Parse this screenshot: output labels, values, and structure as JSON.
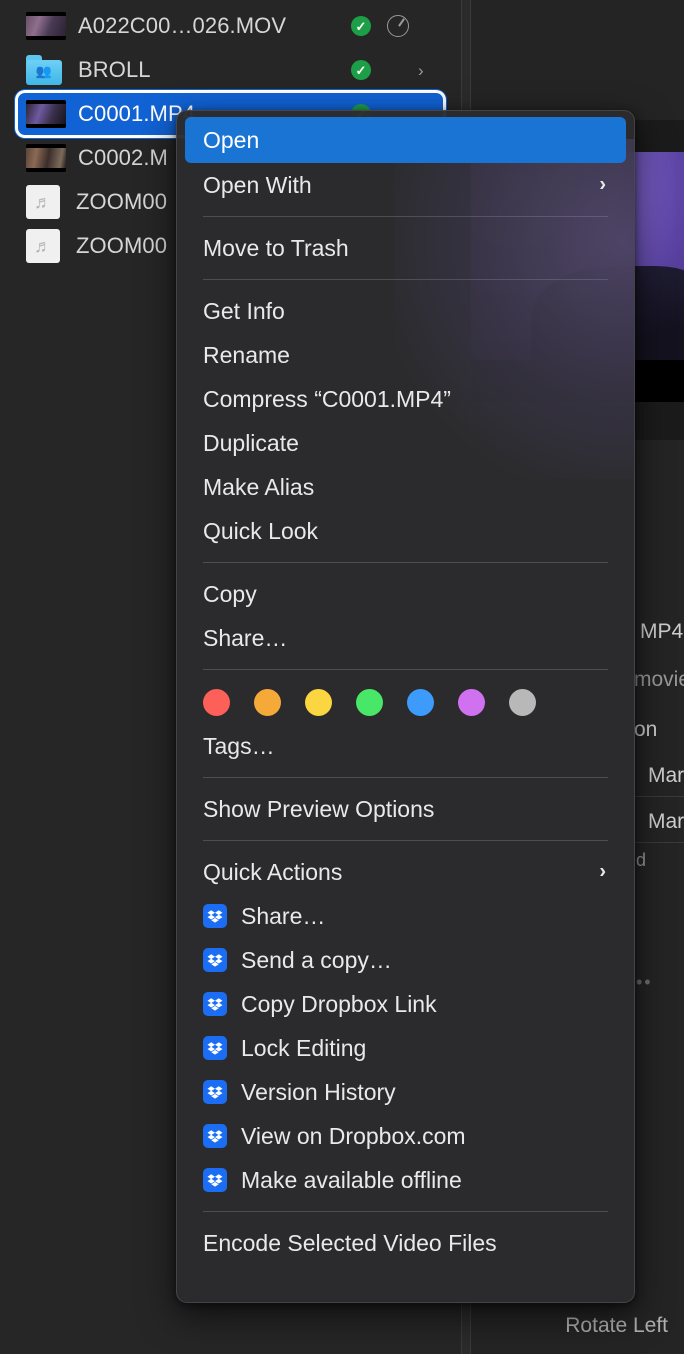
{
  "file_list": {
    "items": [
      {
        "name": "A022C00…026.MOV",
        "icon": "video-thumbnail-icon",
        "kind": "video",
        "sync_badge": "sync-complete-icon",
        "extra_icon": "sync-progress-pie-icon",
        "chevron": "",
        "selected": false
      },
      {
        "name": "BROLL",
        "icon": "shared-folder-icon",
        "kind": "folder",
        "sync_badge": "sync-complete-icon",
        "extra_icon": "",
        "chevron": "›",
        "selected": false
      },
      {
        "name": "C0001.MP4",
        "icon": "video-thumbnail-icon",
        "kind": "video",
        "sync_badge": "sync-complete-icon",
        "extra_icon": "",
        "chevron": "",
        "selected": true
      },
      {
        "name": "C0002.M",
        "icon": "video-thumbnail-icon",
        "kind": "video",
        "sync_badge": "",
        "extra_icon": "",
        "chevron": "",
        "selected": false
      },
      {
        "name": "ZOOM00",
        "icon": "audio-file-icon",
        "kind": "audio",
        "sync_badge": "",
        "extra_icon": "",
        "chevron": "",
        "selected": false
      },
      {
        "name": "ZOOM00",
        "icon": "audio-file-icon",
        "kind": "audio",
        "sync_badge": "",
        "extra_icon": "",
        "chevron": "",
        "selected": false
      }
    ]
  },
  "context_menu": {
    "sections": [
      {
        "type": "items",
        "items": [
          {
            "label": "Open",
            "highlighted": true,
            "submenu": false,
            "icon": ""
          },
          {
            "label": "Open With",
            "highlighted": false,
            "submenu": true,
            "icon": ""
          }
        ]
      },
      {
        "type": "separator"
      },
      {
        "type": "items",
        "items": [
          {
            "label": "Move to Trash",
            "highlighted": false,
            "submenu": false,
            "icon": ""
          }
        ]
      },
      {
        "type": "separator"
      },
      {
        "type": "items",
        "items": [
          {
            "label": "Get Info",
            "highlighted": false,
            "submenu": false,
            "icon": ""
          },
          {
            "label": "Rename",
            "highlighted": false,
            "submenu": false,
            "icon": ""
          },
          {
            "label": "Compress “C0001.MP4”",
            "highlighted": false,
            "submenu": false,
            "icon": ""
          },
          {
            "label": "Duplicate",
            "highlighted": false,
            "submenu": false,
            "icon": ""
          },
          {
            "label": "Make Alias",
            "highlighted": false,
            "submenu": false,
            "icon": ""
          },
          {
            "label": "Quick Look",
            "highlighted": false,
            "submenu": false,
            "icon": ""
          }
        ]
      },
      {
        "type": "separator"
      },
      {
        "type": "items",
        "items": [
          {
            "label": "Copy",
            "highlighted": false,
            "submenu": false,
            "icon": ""
          },
          {
            "label": "Share…",
            "highlighted": false,
            "submenu": false,
            "icon": ""
          }
        ]
      },
      {
        "type": "separator"
      },
      {
        "type": "tags"
      },
      {
        "type": "items",
        "items": [
          {
            "label": "Tags…",
            "highlighted": false,
            "submenu": false,
            "icon": ""
          }
        ]
      },
      {
        "type": "separator"
      },
      {
        "type": "items",
        "items": [
          {
            "label": "Show Preview Options",
            "highlighted": false,
            "submenu": false,
            "icon": ""
          }
        ]
      },
      {
        "type": "separator"
      },
      {
        "type": "items",
        "items": [
          {
            "label": "Quick Actions",
            "highlighted": false,
            "submenu": true,
            "icon": ""
          },
          {
            "label": "Share…",
            "highlighted": false,
            "submenu": false,
            "icon": "dropbox-icon"
          },
          {
            "label": "Send a copy…",
            "highlighted": false,
            "submenu": false,
            "icon": "dropbox-icon"
          },
          {
            "label": "Copy Dropbox Link",
            "highlighted": false,
            "submenu": false,
            "icon": "dropbox-icon"
          },
          {
            "label": "Lock Editing",
            "highlighted": false,
            "submenu": false,
            "icon": "dropbox-icon"
          },
          {
            "label": "Version History",
            "highlighted": false,
            "submenu": false,
            "icon": "dropbox-icon"
          },
          {
            "label": "View on Dropbox.com",
            "highlighted": false,
            "submenu": false,
            "icon": "dropbox-icon"
          },
          {
            "label": "Make available offline",
            "highlighted": false,
            "submenu": false,
            "icon": "dropbox-icon"
          }
        ]
      },
      {
        "type": "separator"
      },
      {
        "type": "items",
        "items": [
          {
            "label": "Encode Selected Video Files",
            "highlighted": false,
            "submenu": false,
            "icon": ""
          }
        ]
      }
    ],
    "tag_colors": [
      "#fc6058",
      "#f5a938",
      "#fbd640",
      "#49e767",
      "#3d9bfb",
      "#d072f0",
      "#b8b8b8"
    ],
    "submenu_chevron": "›"
  },
  "info_panel": {
    "lines": [
      {
        "text": "MP4",
        "dim": false
      },
      {
        "text": "movie",
        "dim": true
      },
      {
        "text": "on",
        "dim": false
      },
      {
        "text": "Mar",
        "dim": false
      },
      {
        "text": "Mar",
        "dim": false
      },
      {
        "text": "d",
        "dim": true
      }
    ],
    "more_dots": "••"
  },
  "bottom_bar": {
    "rotate_left_label": "Rotate Left"
  },
  "colors": {
    "selection_blue": "#1162d4",
    "menu_highlight_blue": "#1a74d4",
    "sync_green": "#1d9f48",
    "dropbox_blue": "#1b6ef3",
    "menu_bg": "#2c2c2e",
    "window_bg": "#262626"
  }
}
